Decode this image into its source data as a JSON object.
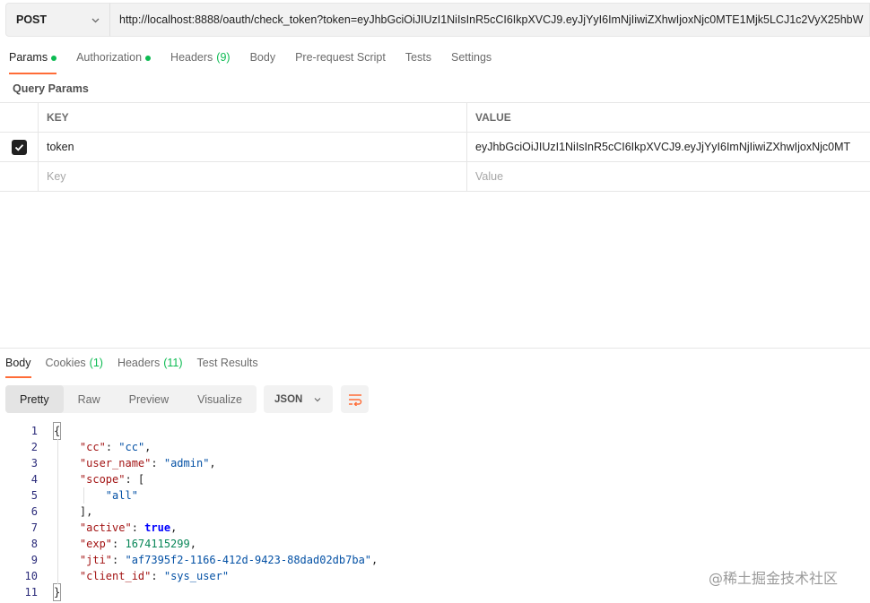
{
  "request": {
    "method": "POST",
    "url": "http://localhost:8888/oauth/check_token?token=eyJhbGciOiJIUzI1NiIsInR5cCI6IkpXVCJ9.eyJjYyI6ImNjIiwiZXhwIjoxNjc0MTE1Mjk5LCJ1c2VyX25hbW"
  },
  "request_tabs": [
    {
      "label": "Params",
      "dot": true,
      "count": "",
      "active": true
    },
    {
      "label": "Authorization",
      "dot": true,
      "count": "",
      "active": false
    },
    {
      "label": "Headers",
      "dot": false,
      "count": "(9)",
      "active": false
    },
    {
      "label": "Body",
      "dot": false,
      "count": "",
      "active": false
    },
    {
      "label": "Pre-request Script",
      "dot": false,
      "count": "",
      "active": false
    },
    {
      "label": "Tests",
      "dot": false,
      "count": "",
      "active": false
    },
    {
      "label": "Settings",
      "dot": false,
      "count": "",
      "active": false
    }
  ],
  "query_params": {
    "title": "Query Params",
    "key_header": "KEY",
    "value_header": "VALUE",
    "rows": [
      {
        "checked": true,
        "key": "token",
        "value": "eyJhbGciOiJIUzI1NiIsInR5cCI6IkpXVCJ9.eyJjYyI6ImNjIiwiZXhwIjoxNjc0MT"
      }
    ],
    "key_placeholder": "Key",
    "value_placeholder": "Value"
  },
  "response_tabs": [
    {
      "label": "Body",
      "count": "",
      "active": true
    },
    {
      "label": "Cookies",
      "count": "(1)",
      "active": false
    },
    {
      "label": "Headers",
      "count": "(11)",
      "active": false
    },
    {
      "label": "Test Results",
      "count": "",
      "active": false
    }
  ],
  "views": [
    {
      "label": "Pretty",
      "active": true
    },
    {
      "label": "Raw",
      "active": false
    },
    {
      "label": "Preview",
      "active": false
    },
    {
      "label": "Visualize",
      "active": false
    }
  ],
  "format": "JSON",
  "code_lines": [
    {
      "n": "1",
      "indent": 0,
      "parts": [
        {
          "t": "{",
          "c": "txt bracket-box"
        }
      ]
    },
    {
      "n": "2",
      "indent": 1,
      "parts": [
        {
          "t": "\"cc\"",
          "c": "k"
        },
        {
          "t": ": ",
          "c": "txt"
        },
        {
          "t": "\"cc\"",
          "c": "s"
        },
        {
          "t": ",",
          "c": "txt"
        }
      ]
    },
    {
      "n": "3",
      "indent": 1,
      "parts": [
        {
          "t": "\"user_name\"",
          "c": "k"
        },
        {
          "t": ": ",
          "c": "txt"
        },
        {
          "t": "\"admin\"",
          "c": "s"
        },
        {
          "t": ",",
          "c": "txt"
        }
      ]
    },
    {
      "n": "4",
      "indent": 1,
      "parts": [
        {
          "t": "\"scope\"",
          "c": "k"
        },
        {
          "t": ": [",
          "c": "txt"
        }
      ]
    },
    {
      "n": "5",
      "indent": 2,
      "parts": [
        {
          "t": "\"all\"",
          "c": "s"
        }
      ]
    },
    {
      "n": "6",
      "indent": 1,
      "parts": [
        {
          "t": "],",
          "c": "txt"
        }
      ]
    },
    {
      "n": "7",
      "indent": 1,
      "parts": [
        {
          "t": "\"active\"",
          "c": "k"
        },
        {
          "t": ": ",
          "c": "txt"
        },
        {
          "t": "true",
          "c": "b"
        },
        {
          "t": ",",
          "c": "txt"
        }
      ]
    },
    {
      "n": "8",
      "indent": 1,
      "parts": [
        {
          "t": "\"exp\"",
          "c": "k"
        },
        {
          "t": ": ",
          "c": "txt"
        },
        {
          "t": "1674115299",
          "c": "n"
        },
        {
          "t": ",",
          "c": "txt"
        }
      ]
    },
    {
      "n": "9",
      "indent": 1,
      "parts": [
        {
          "t": "\"jti\"",
          "c": "k"
        },
        {
          "t": ": ",
          "c": "txt"
        },
        {
          "t": "\"af7395f2-1166-412d-9423-88dad02db7ba\"",
          "c": "s"
        },
        {
          "t": ",",
          "c": "txt"
        }
      ]
    },
    {
      "n": "10",
      "indent": 1,
      "parts": [
        {
          "t": "\"client_id\"",
          "c": "k"
        },
        {
          "t": ": ",
          "c": "txt"
        },
        {
          "t": "\"sys_user\"",
          "c": "s"
        }
      ]
    },
    {
      "n": "11",
      "indent": 0,
      "parts": [
        {
          "t": "}",
          "c": "txt bracket-box"
        }
      ]
    }
  ],
  "watermark": "@稀土掘金技术社区",
  "colors": {
    "accent": "#ff6c37",
    "success": "#0cbb52"
  }
}
